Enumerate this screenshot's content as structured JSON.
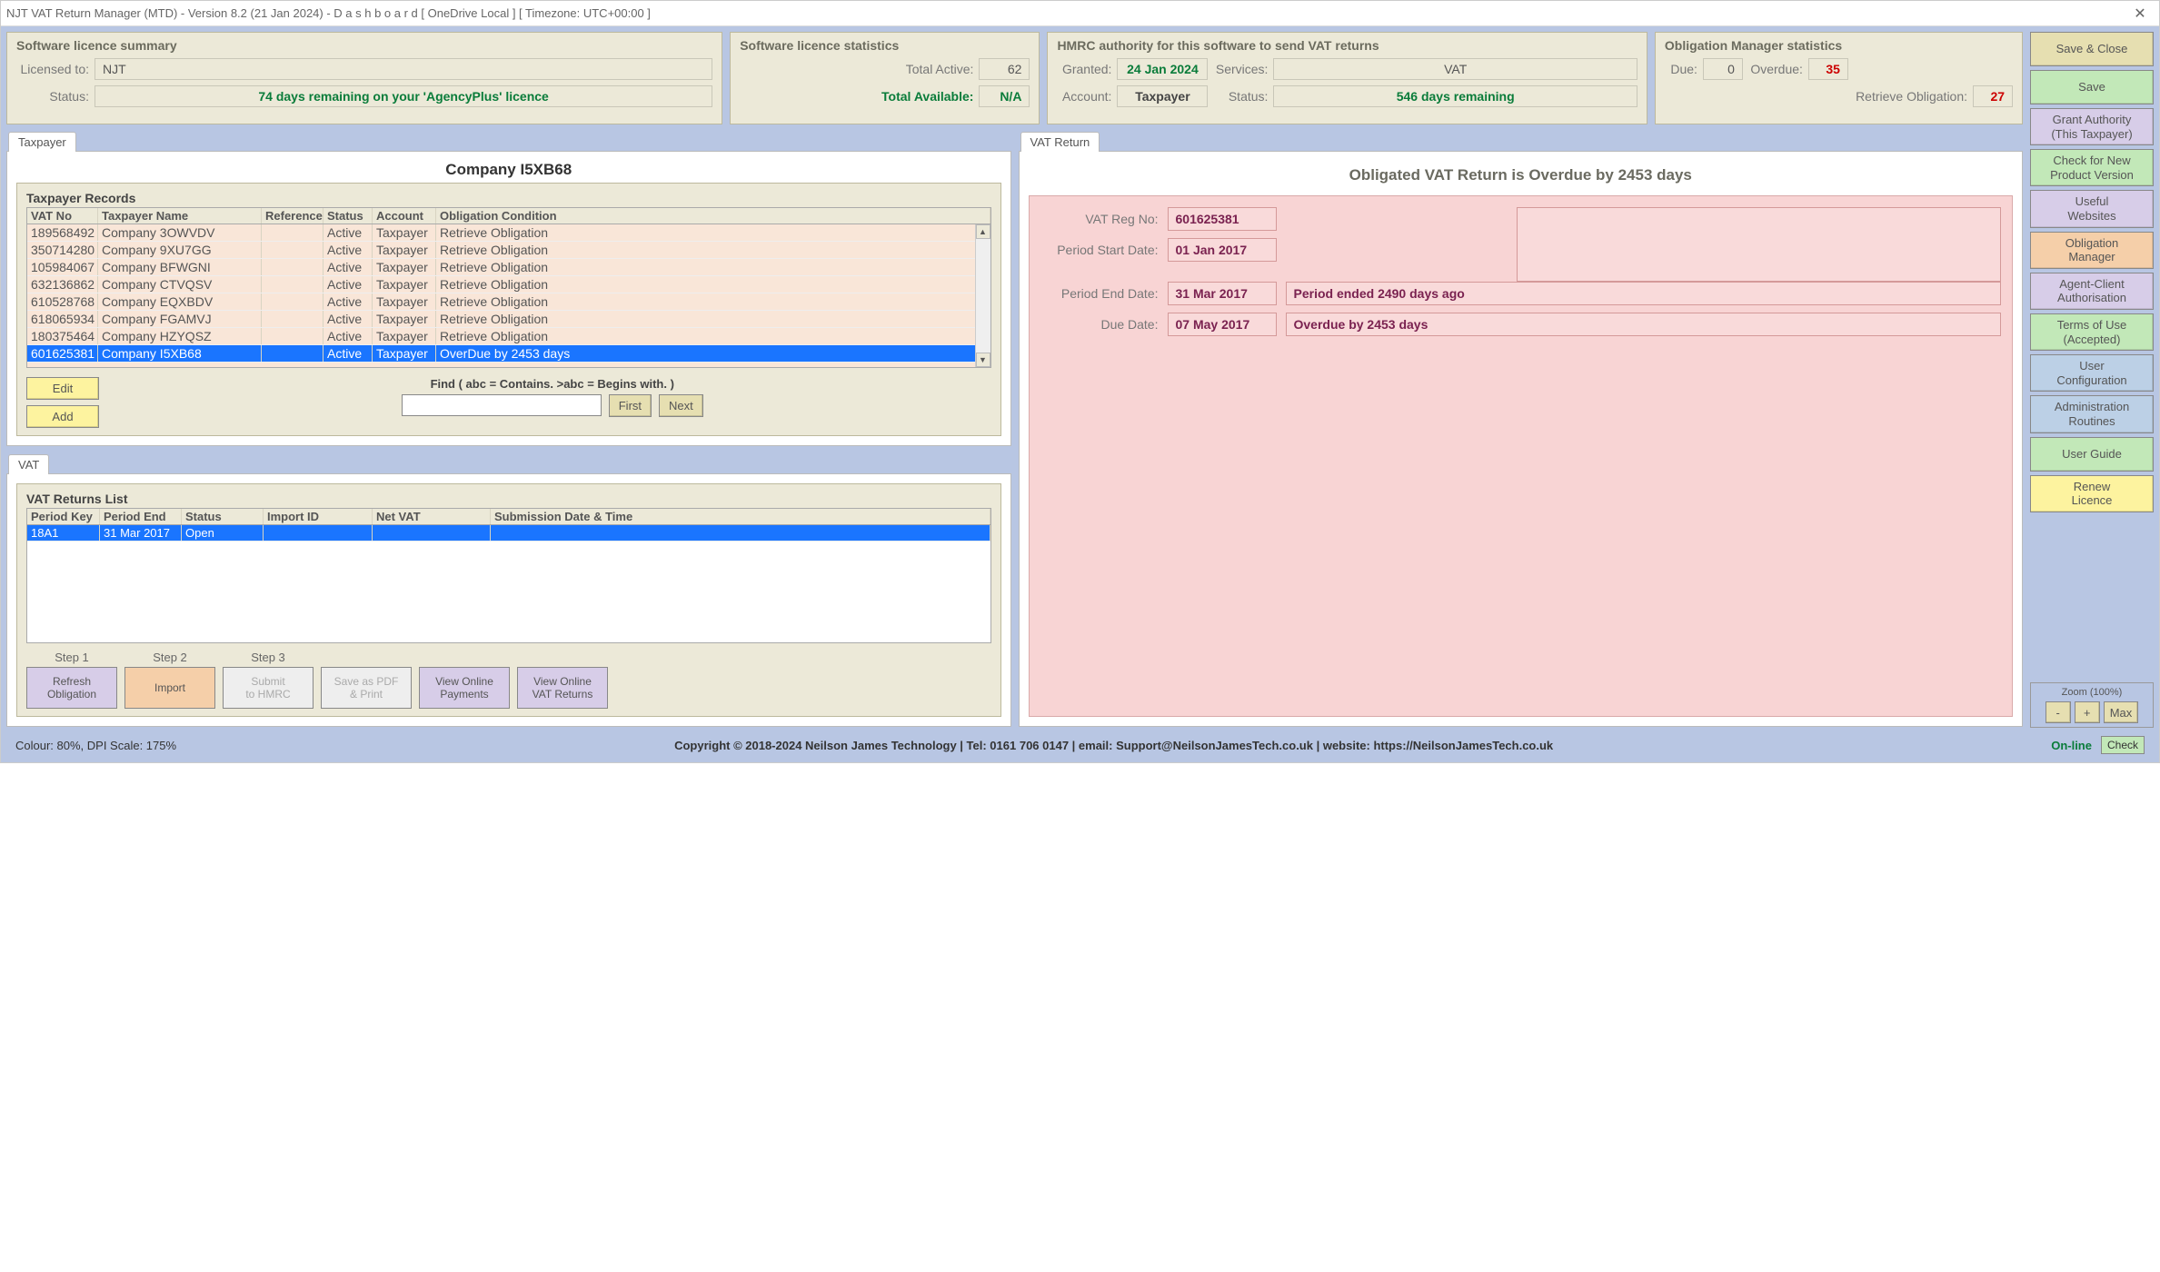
{
  "titlebar": "NJT VAT Return Manager (MTD) - Version 8.2 (21 Jan 2024)  -   D a s h b o a r d   [ OneDrive Local ]   [ Timezone: UTC+00:00 ]",
  "licence_summary": {
    "title": "Software licence summary",
    "licensed_to_lbl": "Licensed to:",
    "licensed_to": "NJT",
    "status_lbl": "Status:",
    "status": "74 days remaining on your 'AgencyPlus' licence"
  },
  "licence_stats": {
    "title": "Software licence statistics",
    "active_lbl": "Total Active:",
    "active": "62",
    "avail_lbl": "Total Available:",
    "avail": "N/A"
  },
  "hmrc": {
    "title": "HMRC authority for this software to send VAT returns",
    "granted_lbl": "Granted:",
    "granted": "24 Jan 2024",
    "services_lbl": "Services:",
    "services": "VAT",
    "account_lbl": "Account:",
    "account": "Taxpayer",
    "status_lbl": "Status:",
    "status": "546 days remaining"
  },
  "obstat": {
    "title": "Obligation Manager statistics",
    "due_lbl": "Due:",
    "due": "0",
    "over_lbl": "Overdue:",
    "overdue": "35",
    "retrieve_lbl": "Retrieve Obligation:",
    "retrieve": "27"
  },
  "sidebar": {
    "save_close": "Save & Close",
    "save": "Save",
    "grant": "Grant Authority\n(This Taxpayer)",
    "check_ver": "Check for New\nProduct Version",
    "useful": "Useful\nWebsites",
    "ob_mgr": "Obligation\nManager",
    "agent": "Agent-Client\nAuthorisation",
    "terms": "Terms of Use\n(Accepted)",
    "user_cfg": "User\nConfiguration",
    "admin": "Administration\nRoutines",
    "guide": "User Guide",
    "renew": "Renew\nLicence",
    "zoom_lbl": "Zoom (100%)",
    "zoom_minus": "-",
    "zoom_plus": "+",
    "zoom_max": "Max"
  },
  "taxpayer_tab": {
    "tab": "Taxpayer",
    "company": "Company I5XB68",
    "records_title": "Taxpayer Records",
    "columns": [
      "VAT No",
      "Taxpayer Name",
      "Reference",
      "Status",
      "Account",
      "Obligation Condition"
    ],
    "rows": [
      {
        "vat": "189568492",
        "name": "Company 3OWVDV",
        "ref": "",
        "status": "Active",
        "acct": "Taxpayer",
        "ob": "Retrieve Obligation",
        "sel": false
      },
      {
        "vat": "350714280",
        "name": "Company 9XU7GG",
        "ref": "",
        "status": "Active",
        "acct": "Taxpayer",
        "ob": "Retrieve Obligation",
        "sel": false
      },
      {
        "vat": "105984067",
        "name": "Company BFWGNI",
        "ref": "",
        "status": "Active",
        "acct": "Taxpayer",
        "ob": "Retrieve Obligation",
        "sel": false
      },
      {
        "vat": "632136862",
        "name": "Company CTVQSV",
        "ref": "",
        "status": "Active",
        "acct": "Taxpayer",
        "ob": "Retrieve Obligation",
        "sel": false
      },
      {
        "vat": "610528768",
        "name": "Company EQXBDV",
        "ref": "",
        "status": "Active",
        "acct": "Taxpayer",
        "ob": "Retrieve Obligation",
        "sel": false
      },
      {
        "vat": "618065934",
        "name": "Company FGAMVJ",
        "ref": "",
        "status": "Active",
        "acct": "Taxpayer",
        "ob": "Retrieve Obligation",
        "sel": false
      },
      {
        "vat": "180375464",
        "name": "Company HZYQSZ",
        "ref": "",
        "status": "Active",
        "acct": "Taxpayer",
        "ob": "Retrieve Obligation",
        "sel": false
      },
      {
        "vat": "601625381",
        "name": "Company I5XB68",
        "ref": "",
        "status": "Active",
        "acct": "Taxpayer",
        "ob": "OverDue by 2453 days",
        "sel": true
      }
    ],
    "edit": "Edit",
    "add": "Add",
    "find_lbl": "Find ( abc = Contains.  >abc = Begins with. )",
    "first": "First",
    "next": "Next"
  },
  "vat_return": {
    "tab": "VAT Return",
    "title": "Obligated VAT Return is Overdue by 2453 days",
    "reg_lbl": "VAT Reg No:",
    "reg": "601625381",
    "psd_lbl": "Period Start Date:",
    "psd": "01 Jan 2017",
    "ped_lbl": "Period End Date:",
    "ped": "31 Mar 2017",
    "ped_note": "Period ended 2490 days ago",
    "due_lbl": "Due Date:",
    "due": "07 May 2017",
    "due_note": "Overdue by 2453 days"
  },
  "vat_tab": {
    "tab": "VAT",
    "title": "VAT Returns List",
    "columns": [
      "Period Key",
      "Period End",
      "Status",
      "Import ID",
      "Net VAT",
      "Submission Date & Time"
    ],
    "rows": [
      {
        "pk": "18A1",
        "pe": "31 Mar 2017",
        "st": "Open",
        "ii": "",
        "nv": "",
        "sd": "",
        "sel": true
      }
    ],
    "step1": "Step 1",
    "step2": "Step 2",
    "step3": "Step 3",
    "refresh": "Refresh\nObligation",
    "import": "Import",
    "submit": "Submit\nto HMRC",
    "pdf": "Save as PDF\n& Print",
    "payments": "View Online\nPayments",
    "returns": "View Online\nVAT Returns"
  },
  "footer": {
    "colour": "Colour: 80%, DPI Scale: 175%",
    "copy": "Copyright © 2018-2024 Neilson James Technology   |   Tel: 0161 706 0147   |   email: Support@NeilsonJamesTech.co.uk   |   website: https://NeilsonJamesTech.co.uk",
    "online": "On-line",
    "check": "Check"
  }
}
